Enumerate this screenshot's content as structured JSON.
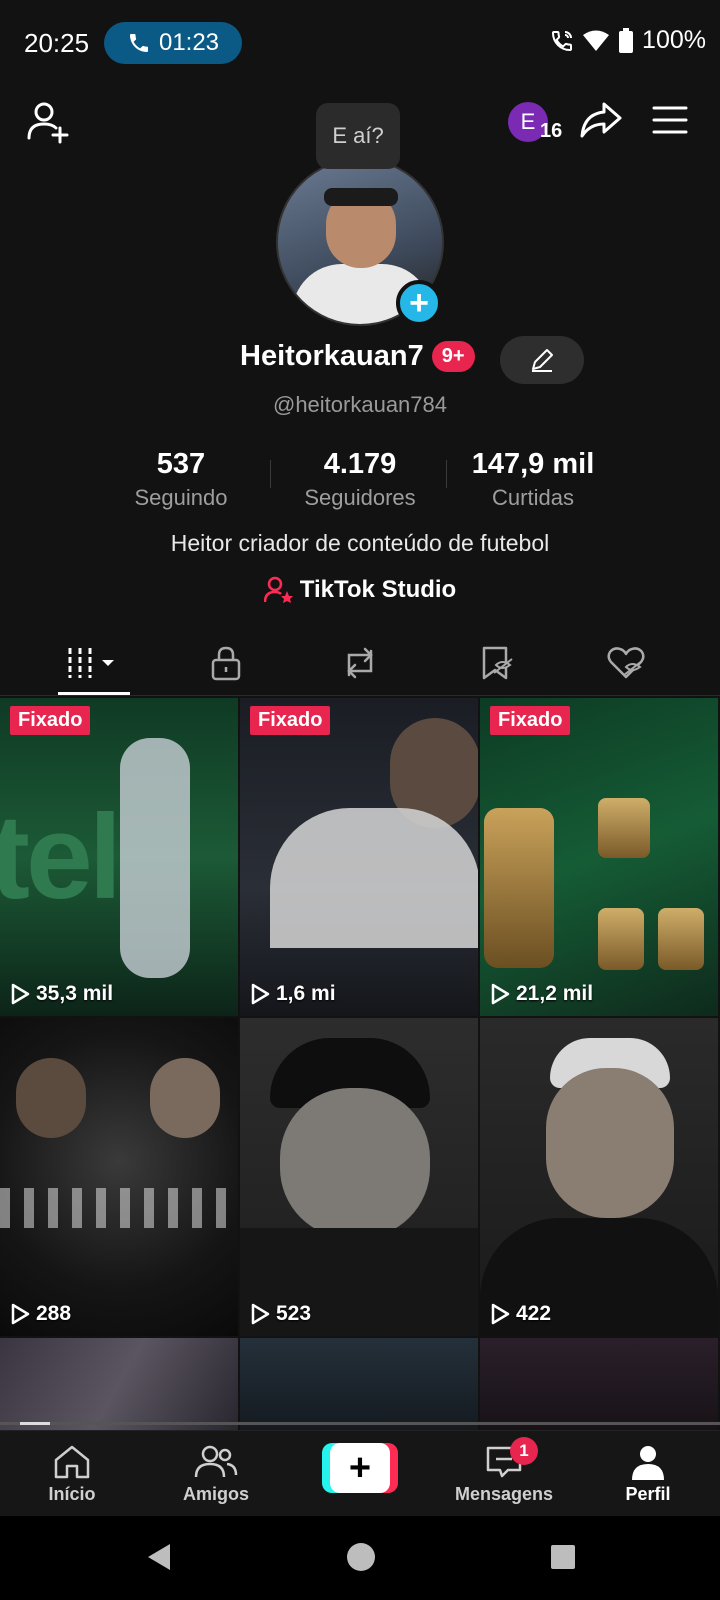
{
  "status_bar": {
    "time": "20:25",
    "call_timer": "01:23",
    "battery": "100%"
  },
  "header": {
    "avatar_initial": "E",
    "avatar_count": "16",
    "bubble_text": "E aí?"
  },
  "profile": {
    "username": "Heitorkauan7",
    "notif_badge": "9+",
    "handle": "@heitorkauan784",
    "stats": [
      {
        "value": "537",
        "label": "Seguindo"
      },
      {
        "value": "4.179",
        "label": "Seguidores"
      },
      {
        "value": "147,9 mil",
        "label": "Curtidas"
      }
    ],
    "bio": "Heitor criador de conteúdo de futebol",
    "studio_link": "TikTok Studio"
  },
  "videos": [
    {
      "pinned": "Fixado",
      "views": "35,3 mil"
    },
    {
      "pinned": "Fixado",
      "views": "1,6 mi"
    },
    {
      "pinned": "Fixado",
      "views": "21,2 mil"
    },
    {
      "pinned": "",
      "views": "288"
    },
    {
      "pinned": "",
      "views": "523"
    },
    {
      "pinned": "",
      "views": "422"
    }
  ],
  "bottom_nav": {
    "home": "Início",
    "friends": "Amigos",
    "messages": "Mensagens",
    "messages_badge": "1",
    "profile": "Perfil"
  },
  "colors": {
    "accent": "#e8254f",
    "add_blue": "#25b7e8",
    "call_blue": "#0b5a86"
  }
}
